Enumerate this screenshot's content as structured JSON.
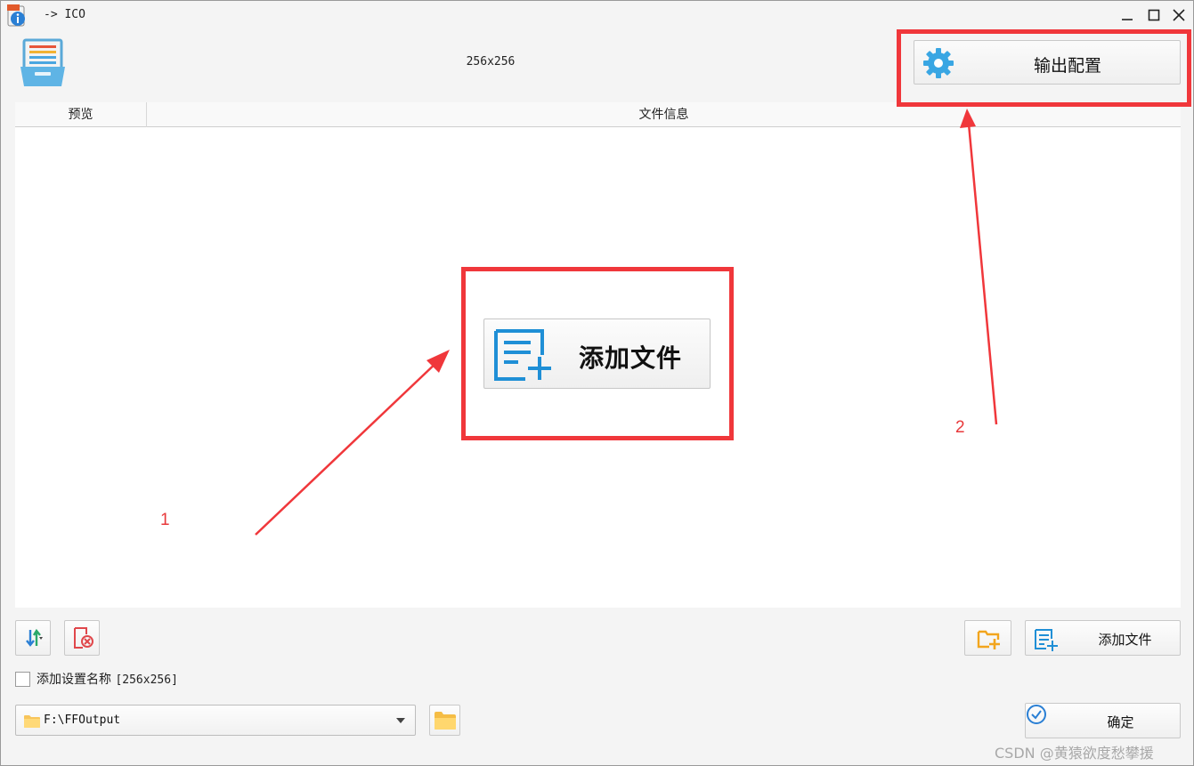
{
  "window": {
    "title": "-> ICO",
    "minimize_glyph": "_",
    "maximize_glyph": "□",
    "close_glyph": "✕"
  },
  "header": {
    "preset_label": "256x256",
    "output_config_label": "输出配置",
    "output_config_icon": "gear-icon"
  },
  "table": {
    "columns": [
      "预览",
      "文件信息"
    ],
    "center_add_label": "添加文件",
    "center_add_icon": "add-file-icon"
  },
  "toolbar": {
    "sort_icon": "sort-icon",
    "clear_icon": "clear-list-icon",
    "add_folder_icon": "add-folder-icon",
    "add_file_label": "添加文件"
  },
  "options": {
    "append_setting_name_label": "添加设置名称",
    "append_setting_name_suffix": "[256x256]",
    "append_setting_name_checked": false
  },
  "output": {
    "path_value": "F:\\FFOutput",
    "ok_label": "确定"
  },
  "annotations": {
    "label_1": "1",
    "label_2": "2",
    "color": "#f0373b"
  },
  "watermark": "CSDN @黄猿欲度愁攀援"
}
